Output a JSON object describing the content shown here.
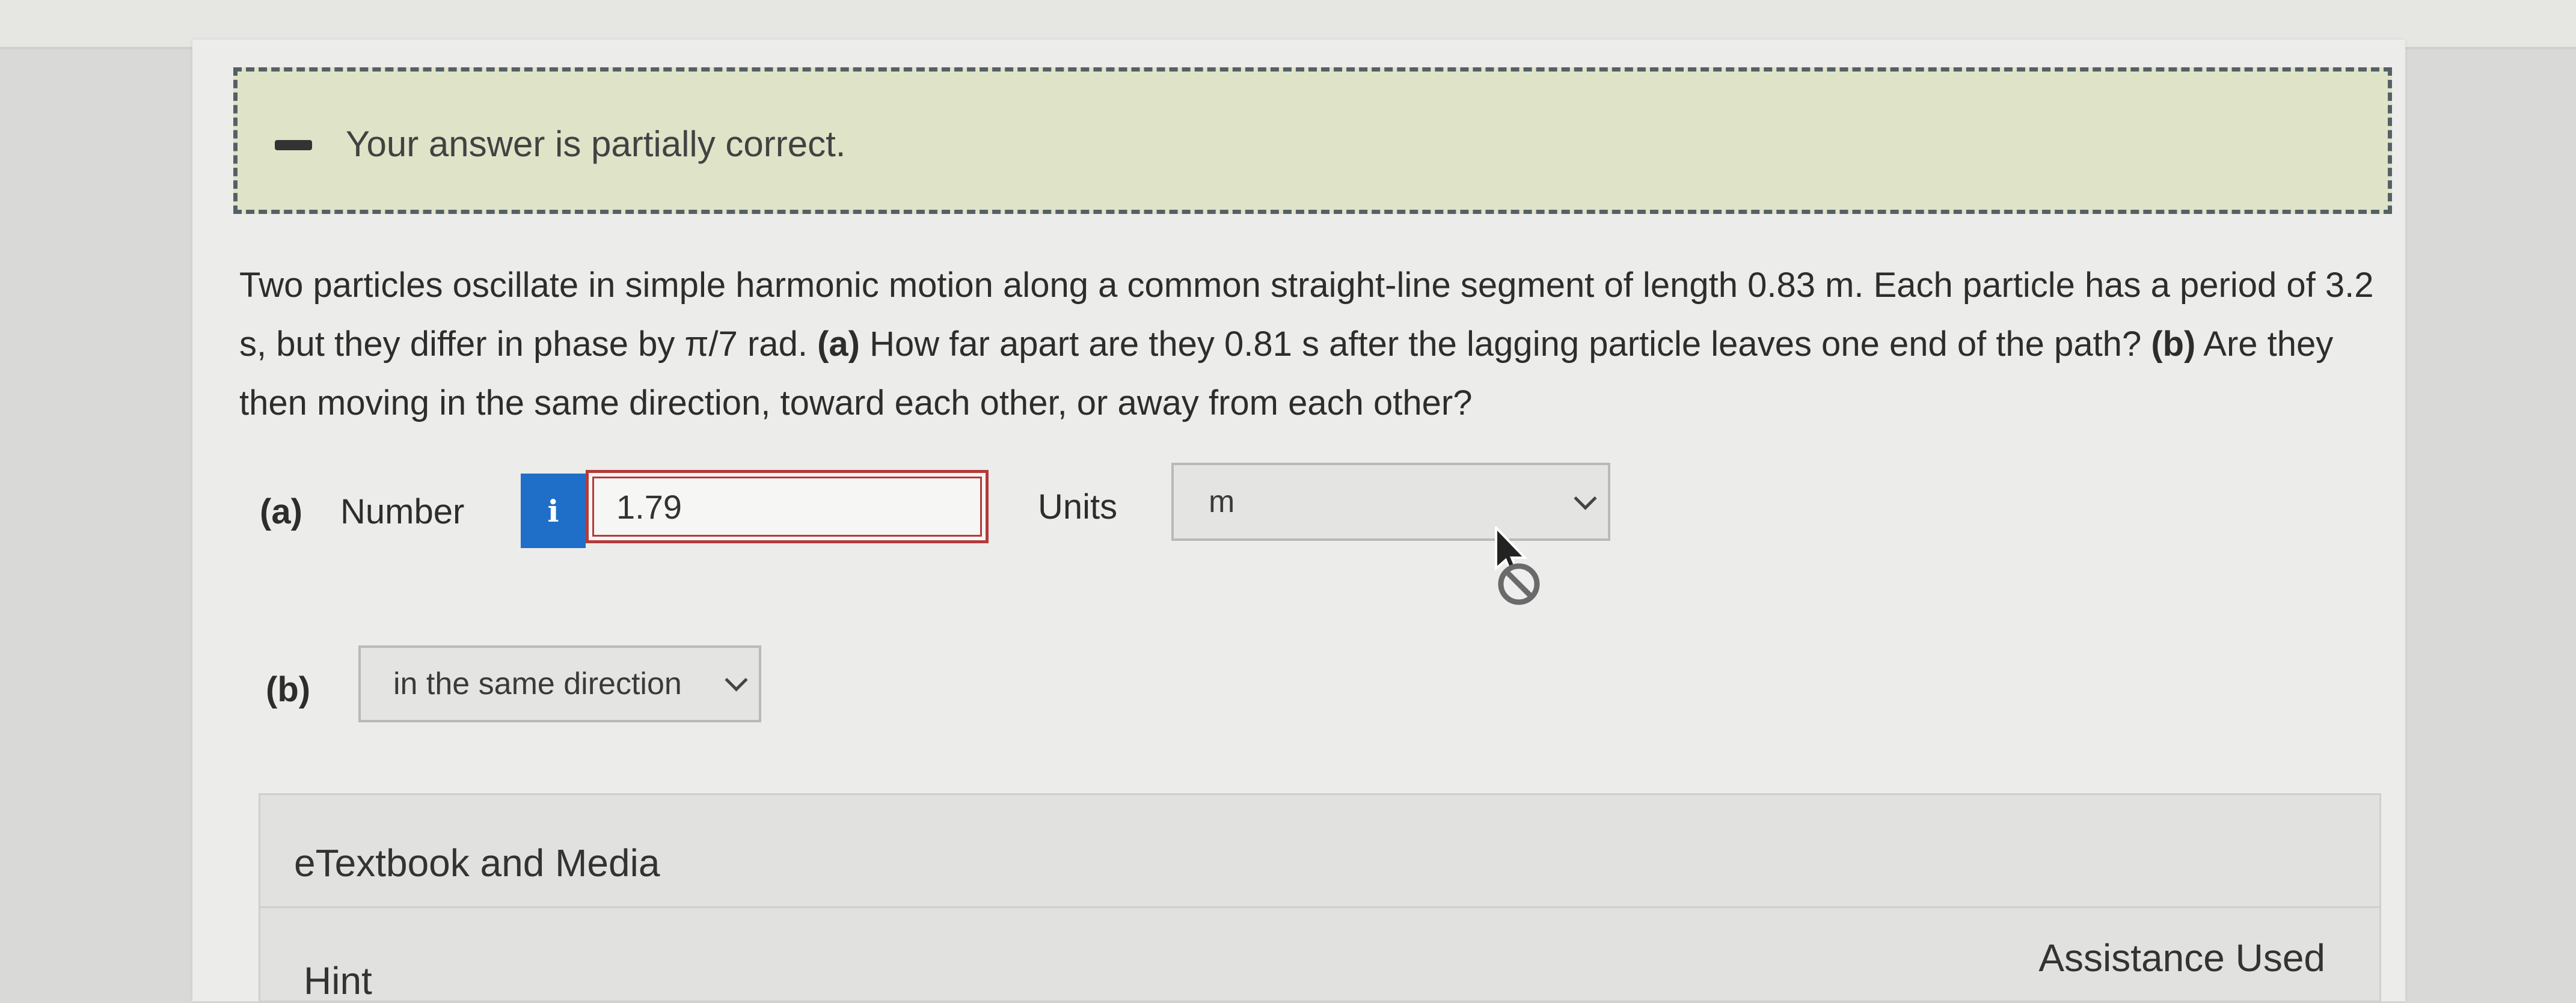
{
  "feedback": {
    "message": "Your answer is partially correct."
  },
  "question": {
    "text_1": "Two particles oscillate in simple harmonic motion along a common straight-line segment of length 0.83 m. Each particle has a period of 3.2 s, but they differ in phase by π/7 rad. ",
    "part_a_label": "(a)",
    "text_2": " How far apart are they 0.81 s after the lagging particle leaves one end of the path? ",
    "part_b_label": "(b)",
    "text_3": " Are they then moving in the same direction, toward each other, or away from each other?"
  },
  "part_a": {
    "label": "(a)",
    "number_label": "Number",
    "info_glyph": "i",
    "value": "1.79",
    "units_label": "Units",
    "units_value": "m"
  },
  "part_b": {
    "label": "(b)",
    "value": "in the same direction"
  },
  "sections": {
    "etextbook": "eTextbook and Media",
    "hint": "Hint",
    "assistance": "Assistance Used"
  },
  "colors": {
    "feedback_bg": "#dfe3c8",
    "info_button": "#1f6fc8",
    "error_border": "#b43a3a"
  }
}
